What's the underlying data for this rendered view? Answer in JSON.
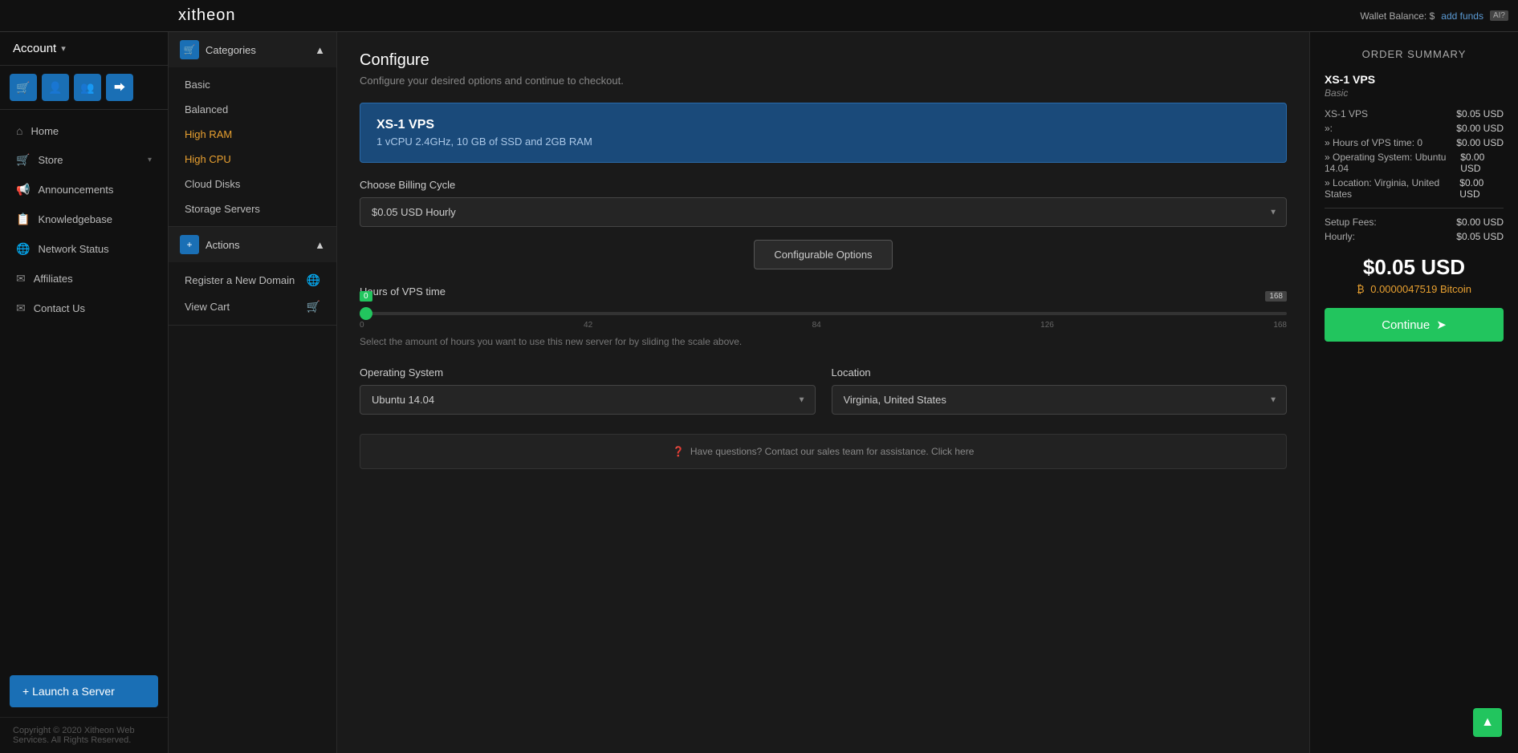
{
  "topbar": {
    "logo": "xitheon",
    "wallet_label": "Wallet Balance: $",
    "add_funds_label": "add funds",
    "ai_badge": "AI?"
  },
  "sidebar": {
    "account_label": "Account",
    "icon_buttons": [
      {
        "name": "cart-icon-btn",
        "icon": "🛒"
      },
      {
        "name": "user-icon-btn",
        "icon": "👤"
      },
      {
        "name": "users-icon-btn",
        "icon": "👥"
      },
      {
        "name": "signout-icon-btn",
        "icon": "⮕"
      }
    ],
    "nav_items": [
      {
        "label": "Home",
        "icon": "🏠",
        "has_chevron": false
      },
      {
        "label": "Store",
        "icon": "🛒",
        "has_chevron": true
      },
      {
        "label": "Announcements",
        "icon": "📢",
        "has_chevron": false
      },
      {
        "label": "Knowledgebase",
        "icon": "📋",
        "has_chevron": false
      },
      {
        "label": "Network Status",
        "icon": "🌐",
        "has_chevron": false
      },
      {
        "label": "Affiliates",
        "icon": "✉",
        "has_chevron": false
      },
      {
        "label": "Contact Us",
        "icon": "✉",
        "has_chevron": false
      }
    ],
    "launch_button_label": "+ Launch a Server",
    "footer": "Copyright © 2020 Xitheon Web Services. All Rights Reserved."
  },
  "categories_panel": {
    "header_label": "Categories",
    "items": [
      {
        "label": "Basic",
        "highlighted": false
      },
      {
        "label": "Balanced",
        "highlighted": false
      },
      {
        "label": "High RAM",
        "highlighted": true
      },
      {
        "label": "High CPU",
        "highlighted": true
      },
      {
        "label": "Cloud Disks",
        "highlighted": false
      },
      {
        "label": "Storage Servers",
        "highlighted": false
      }
    ]
  },
  "actions_panel": {
    "header_label": "Actions",
    "items": [
      {
        "label": "Register a New Domain",
        "icon": "🌐"
      },
      {
        "label": "View Cart",
        "icon": "🛒"
      }
    ]
  },
  "configure": {
    "title": "Configure",
    "subtitle": "Configure your desired options and continue to checkout.",
    "product_name": "XS-1 VPS",
    "product_desc": "1 vCPU 2.4GHz, 10 GB of SSD and 2GB RAM",
    "billing_cycle_label": "Choose Billing Cycle",
    "billing_option": "$0.05 USD Hourly",
    "configurable_btn_label": "Configurable Options",
    "slider_label": "Hours of VPS time",
    "slider_value": 0,
    "slider_max": 168,
    "slider_badge": "168",
    "slider_ticks": [
      "0",
      "42",
      "84",
      "126",
      "168"
    ],
    "slider_hint": "Select the amount of hours you want to use this new server for by sliding the scale above.",
    "os_label": "Operating System",
    "os_value": "Ubuntu 14.04",
    "location_label": "Location",
    "location_value": "Virginia, United States",
    "help_text": "Have questions? Contact our sales team for assistance. Click here"
  },
  "order_summary": {
    "title": "ORDER SUMMARY",
    "product_name": "XS-1 VPS",
    "product_sub": "Basic",
    "lines": [
      {
        "label": "XS-1 VPS",
        "value": "$0.05 USD"
      },
      {
        "label": "»:",
        "value": "$0.00 USD"
      },
      {
        "label": "» Hours of VPS time: 0",
        "value": "$0.00 USD"
      },
      {
        "label": "» Operating System: Ubuntu 14.04",
        "value": "$0.00 USD"
      },
      {
        "label": "» Location: Virginia, United States",
        "value": "$0.00 USD"
      }
    ],
    "setup_fees_label": "Setup Fees:",
    "setup_fees_value": "$0.00 USD",
    "hourly_label": "Hourly:",
    "hourly_value": "$0.05 USD",
    "total_usd": "$0.05 USD",
    "total_btc": "≈8 0.0000047519 Bitcoin",
    "continue_label": "Continue"
  },
  "scroll_top_icon": "▲"
}
